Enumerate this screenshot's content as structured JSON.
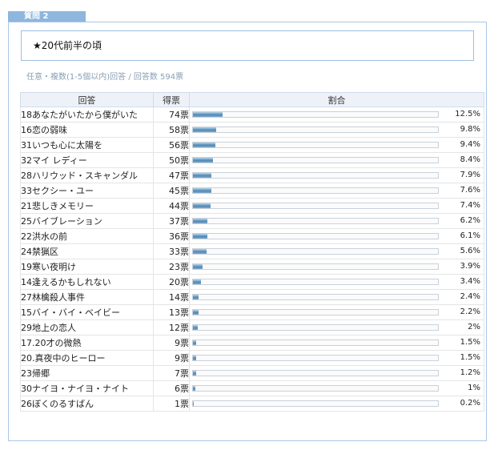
{
  "question": {
    "tab_label": "質問 2",
    "title": "★20代前半の頃",
    "meta": "任意・複数(1-5個以内)回答 / 回答数 594票"
  },
  "table": {
    "headers": {
      "answer": "回答",
      "votes": "得票",
      "ratio": "割合"
    },
    "rows": [
      {
        "label": "18あなたがいたから僕がいた",
        "votes": "74票",
        "pct": "12.5%",
        "ratio": 12.5
      },
      {
        "label": "16恋の弱味",
        "votes": "58票",
        "pct": "9.8%",
        "ratio": 9.8
      },
      {
        "label": "31いつも心に太陽を",
        "votes": "56票",
        "pct": "9.4%",
        "ratio": 9.4
      },
      {
        "label": "32マイ レディー",
        "votes": "50票",
        "pct": "8.4%",
        "ratio": 8.4
      },
      {
        "label": "28ハリウッド・スキャンダル",
        "votes": "47票",
        "pct": "7.9%",
        "ratio": 7.9
      },
      {
        "label": "33セクシー・ユー",
        "votes": "45票",
        "pct": "7.6%",
        "ratio": 7.6
      },
      {
        "label": "21悲しきメモリー",
        "votes": "44票",
        "pct": "7.4%",
        "ratio": 7.4
      },
      {
        "label": "25バイブレーション",
        "votes": "37票",
        "pct": "6.2%",
        "ratio": 6.2
      },
      {
        "label": "22洪水の前",
        "votes": "36票",
        "pct": "6.1%",
        "ratio": 6.1
      },
      {
        "label": "24禁猟区",
        "votes": "33票",
        "pct": "5.6%",
        "ratio": 5.6
      },
      {
        "label": "19寒い夜明け",
        "votes": "23票",
        "pct": "3.9%",
        "ratio": 3.9
      },
      {
        "label": "14逢えるかもしれない",
        "votes": "20票",
        "pct": "3.4%",
        "ratio": 3.4
      },
      {
        "label": "27林檎殺人事件",
        "votes": "14票",
        "pct": "2.4%",
        "ratio": 2.4
      },
      {
        "label": "15バイ・バイ・ベイビー",
        "votes": "13票",
        "pct": "2.2%",
        "ratio": 2.2
      },
      {
        "label": "29地上の恋人",
        "votes": "12票",
        "pct": "2%",
        "ratio": 2.0
      },
      {
        "label": "17.20才の微熱",
        "votes": "9票",
        "pct": "1.5%",
        "ratio": 1.5
      },
      {
        "label": "20.真夜中のヒーロー",
        "votes": "9票",
        "pct": "1.5%",
        "ratio": 1.5
      },
      {
        "label": "23帰郷",
        "votes": "7票",
        "pct": "1.2%",
        "ratio": 1.2
      },
      {
        "label": "30ナイヨ・ナイヨ・ナイト",
        "votes": "6票",
        "pct": "1%",
        "ratio": 1.0
      },
      {
        "label": "26ぼくのるすばん",
        "votes": "1票",
        "pct": "0.2%",
        "ratio": 0.2
      }
    ]
  }
}
